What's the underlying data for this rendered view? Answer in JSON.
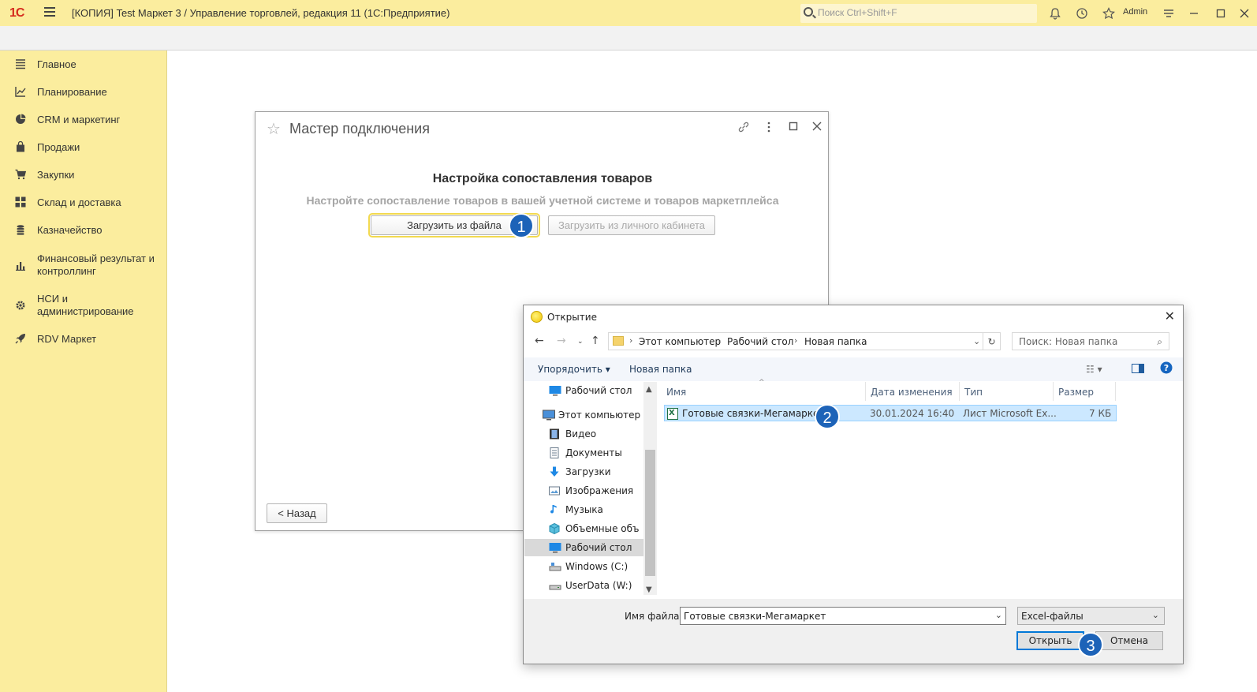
{
  "titlebar": {
    "logo": "1С",
    "title": "[КОПИЯ] Test Маркет 3 / Управление торговлей, редакция 11  (1С:Предприятие)",
    "search_placeholder": "Поиск Ctrl+Shift+F",
    "user": "Admin"
  },
  "sidebar": {
    "items": [
      {
        "label": "Главное",
        "icon": "menu-icon"
      },
      {
        "label": "Планирование",
        "icon": "chart-line-icon"
      },
      {
        "label": "CRM и маркетинг",
        "icon": "pie-chart-icon"
      },
      {
        "label": "Продажи",
        "icon": "bag-icon"
      },
      {
        "label": "Закупки",
        "icon": "cart-icon"
      },
      {
        "label": "Склад и доставка",
        "icon": "grid-icon"
      },
      {
        "label": "Казначейство",
        "icon": "coins-icon"
      },
      {
        "label": "Финансовый результат и контроллинг",
        "icon": "bar-chart-icon"
      },
      {
        "label": "НСИ и администрирование",
        "icon": "gear-icon"
      },
      {
        "label": "RDV Маркет",
        "icon": "rocket-icon"
      }
    ]
  },
  "master": {
    "title": "Мастер подключения",
    "heading": "Настройка сопоставления товаров",
    "subtitle": "Настройте сопоставление товаров в вашей учетной системе и товаров маркетплейса",
    "btn_file": "Загрузить из файла",
    "btn_cabinet": "Загрузить из личного кабинета",
    "btn_back": "< Назад"
  },
  "badges": [
    "1",
    "2",
    "3"
  ],
  "open_dialog": {
    "title": "Открытие",
    "path": [
      "Этот компьютер",
      "Рабочий стол",
      "Новая папка"
    ],
    "search_placeholder": "Поиск: Новая папка",
    "organize": "Упорядочить",
    "new_folder": "Новая папка",
    "tree": [
      {
        "label": "Рабочий стол",
        "icon": "desktop-icon"
      },
      {
        "label": "Этот компьютер",
        "icon": "computer-icon"
      },
      {
        "label": "Видео",
        "icon": "video-icon"
      },
      {
        "label": "Документы",
        "icon": "documents-icon"
      },
      {
        "label": "Загрузки",
        "icon": "download-icon"
      },
      {
        "label": "Изображения",
        "icon": "images-icon"
      },
      {
        "label": "Музыка",
        "icon": "music-icon"
      },
      {
        "label": "Объемные объ",
        "icon": "3d-objects-icon"
      },
      {
        "label": "Рабочий стол",
        "icon": "desktop-icon"
      },
      {
        "label": "Windows (C:)",
        "icon": "drive-icon"
      },
      {
        "label": "UserData (W:)",
        "icon": "drive-icon"
      }
    ],
    "columns": [
      "Имя",
      "Дата изменения",
      "Тип",
      "Размер"
    ],
    "file": {
      "name": "Готовые связки-Мегамаркет",
      "date": "30.01.2024 16:40",
      "type": "Лист Microsoft Ex...",
      "size": "7 КБ"
    },
    "filename_label": "Имя файла:",
    "filename_value": "Готовые связки-Мегамаркет",
    "filetype": "Excel-файлы",
    "btn_open": "Открыть",
    "btn_cancel": "Отмена"
  }
}
